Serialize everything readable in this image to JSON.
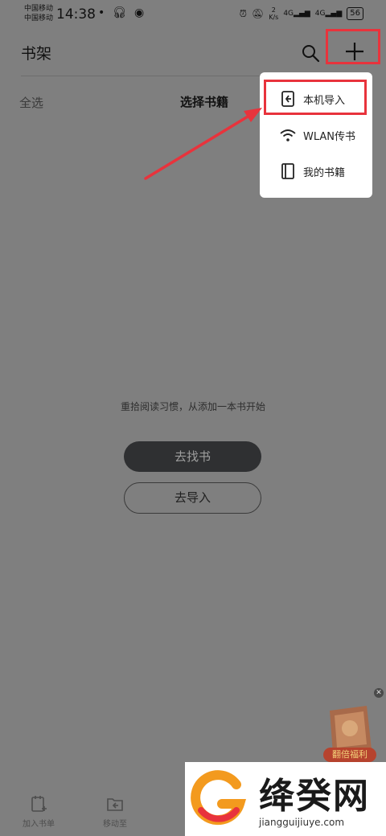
{
  "status": {
    "carrier1": "中国移动",
    "carrier2": "中国移动",
    "time": "14:38",
    "speed_value": "2",
    "speed_unit": "K/s",
    "net1": "4G",
    "net2": "4G",
    "battery": "56"
  },
  "header": {
    "title": "书架"
  },
  "selection": {
    "select_all": "全选",
    "title": "选择书籍"
  },
  "empty": {
    "message": "重拾阅读习惯，从添加一本书开始",
    "find_label": "去找书",
    "import_label": "去导入"
  },
  "menu": {
    "items": [
      {
        "label": "本机导入",
        "icon": "phone-import-icon"
      },
      {
        "label": "WLAN传书",
        "icon": "wifi-icon"
      },
      {
        "label": "我的书籍",
        "icon": "book-icon"
      }
    ]
  },
  "bottom": {
    "add_to_list": "加入书单",
    "move_to": "移动至"
  },
  "promo": {
    "label": "翻倍福利"
  },
  "watermark": {
    "name": "绛癸网",
    "url": "jiangguijiuye.com"
  },
  "colors": {
    "overlay": "#7f7f7f",
    "annotation": "#e8333c",
    "menu_bg": "#ffffff",
    "primary_button": "#2f3032"
  }
}
